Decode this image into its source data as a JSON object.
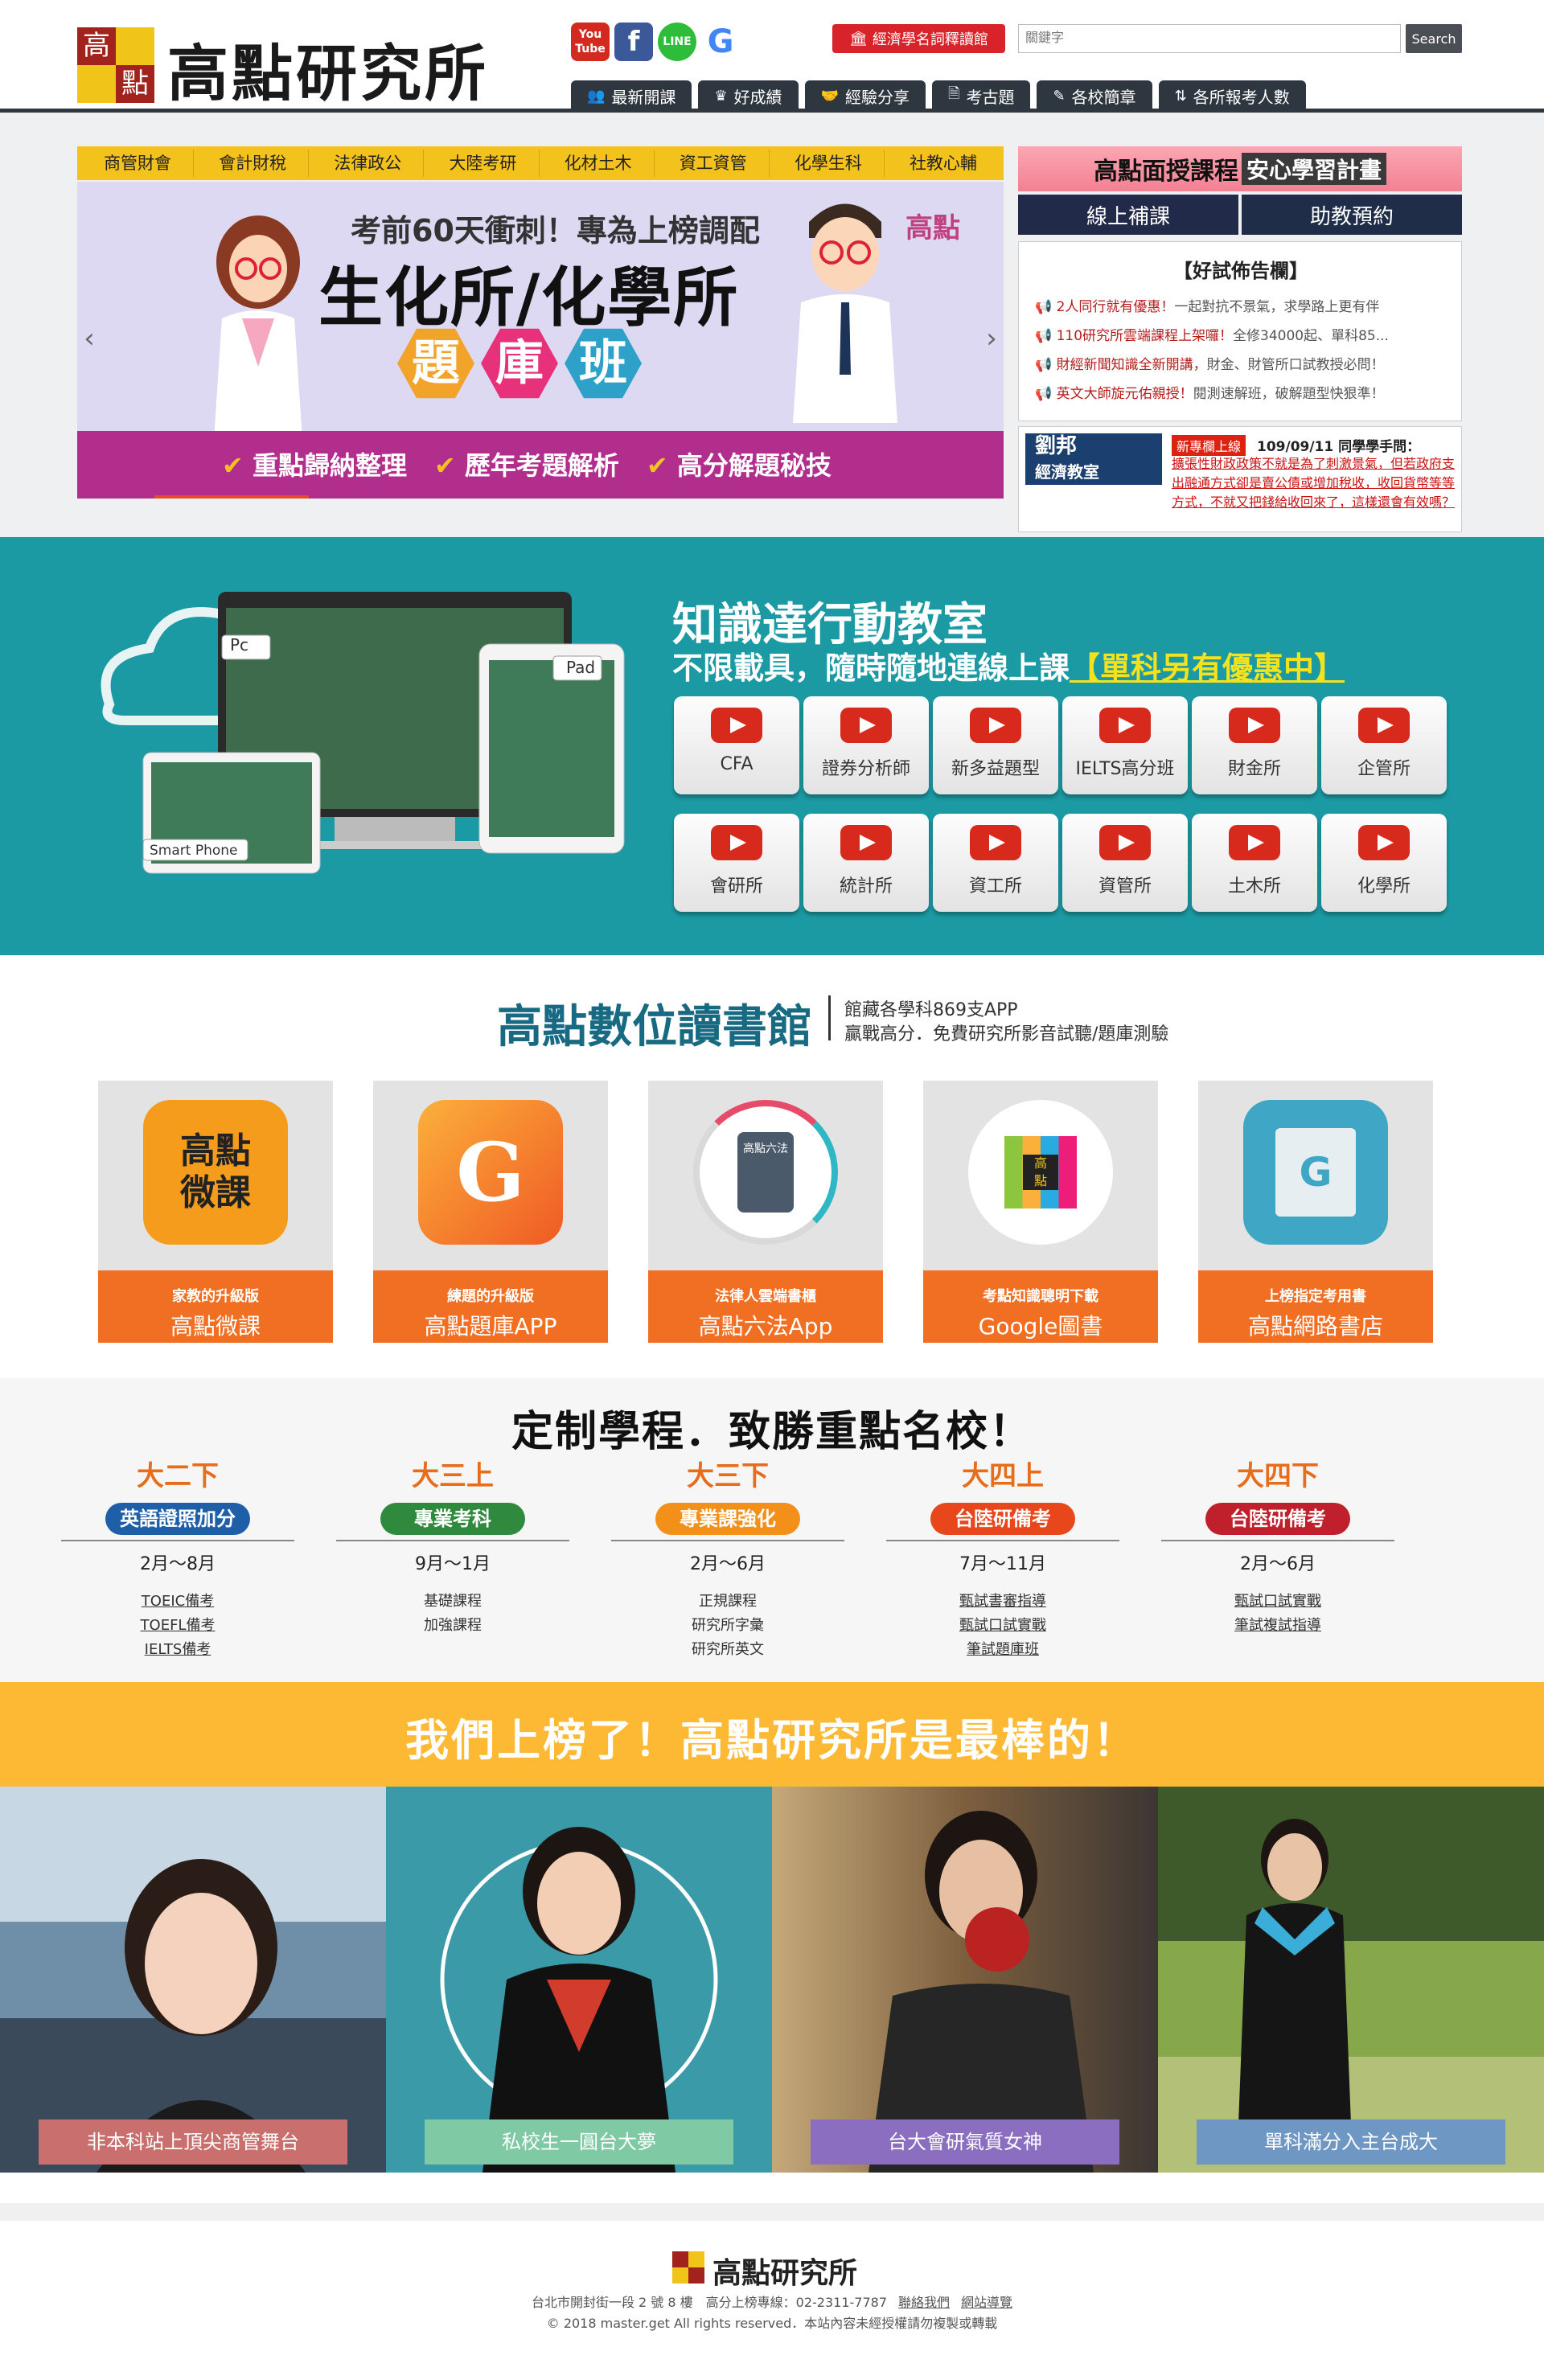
{
  "header": {
    "logo_chars": [
      "高",
      "點"
    ],
    "site_name": "高點研究所",
    "social": [
      {
        "name": "youtube",
        "label": "You\nTube",
        "color": "#d32a1f"
      },
      {
        "name": "facebook",
        "label": "f",
        "color": "#3b5998"
      },
      {
        "name": "line",
        "label": "LINE",
        "color": "#2dbd3b"
      },
      {
        "name": "google",
        "label": "G",
        "color": "#ffffff"
      }
    ],
    "econ_button": "經濟學名詞釋讀館",
    "search_placeholder": "關鍵字",
    "search_button": "Search",
    "nav": [
      {
        "label": "最新開課",
        "icon": "group-icon"
      },
      {
        "label": "好成績",
        "icon": "crown-icon"
      },
      {
        "label": "經驗分享",
        "icon": "handshake-icon"
      },
      {
        "label": "考古題",
        "icon": "document-icon"
      },
      {
        "label": "各校簡章",
        "icon": "edit-icon"
      },
      {
        "label": "各所報考人數",
        "icon": "sort-icon"
      }
    ]
  },
  "hero": {
    "subjects": [
      "商管財會",
      "會計財稅",
      "法律政公",
      "大陸考研",
      "化材土木",
      "資工資管",
      "化學生科",
      "社教心輔"
    ],
    "banner": {
      "line1": "考前60天衝刺！專為上榜調配",
      "line2": "生化所/化學所",
      "hex_chars": [
        "題",
        "庫",
        "班"
      ],
      "brand": "高點",
      "bullets": [
        "重點歸納整理",
        "歷年考題解析",
        "高分解題秘技"
      ]
    }
  },
  "sidebar": {
    "plan_title_a": "高點面授課程",
    "plan_title_b": "安心學習計畫",
    "tab_online": "線上補課",
    "tab_ta": "助教預約",
    "news_title": "【好試佈告欄】",
    "news": [
      {
        "red": "2人同行就有優惠！",
        "gray": "一起對抗不景氣，求學路上更有伴"
      },
      {
        "red": "110研究所雲端課程上架囉！",
        "gray": "全修34000起、單科85..."
      },
      {
        "red": "財經新聞知識全新開講，",
        "gray": "財金、財管所口試教授必問！"
      },
      {
        "red": "英文大師旋元佑親授！",
        "gray": "閱測速解班，破解題型快狠準！"
      }
    ],
    "ad": {
      "thumb_line1": "劉邦",
      "thumb_line2": "經濟教室",
      "tag": "新專欄上線",
      "date": "109/09/11 同學學手問：",
      "text": "擴張性財政政策不就是為了刺激景氣，但若政府支出融通方式卻是賣公債或增加稅收，收回貨幣等等方式，不就又把錢給收回來了，這樣還會有效嗎？"
    }
  },
  "mobile": {
    "title": "知識達行動教室",
    "sub_a": "不限載具，隨時隨地連線上課",
    "sub_b": "【單科另有優惠中】",
    "device_labels": [
      "Pc",
      "Pad",
      "Smart Phone"
    ],
    "buttons": [
      "CFA",
      "證券分析師",
      "新多益題型",
      "IELTS高分班",
      "財金所",
      "企管所",
      "會研所",
      "統計所",
      "資工所",
      "資管所",
      "土木所",
      "化學所"
    ]
  },
  "library": {
    "title": "高點數位讀書館",
    "line1": "館藏各學科869支APP",
    "line2": "贏戰高分．免費研究所影音試聽/題庫測驗",
    "cards": [
      {
        "small": "家教的升級版",
        "big": "高點微課",
        "icon_text": "高點\n微課"
      },
      {
        "small": "練題的升級版",
        "big": "高點題庫APP",
        "icon_text": "G"
      },
      {
        "small": "法律人雲端書櫃",
        "big": "高點六法App",
        "icon_text": "高點六法"
      },
      {
        "small": "考點知識聰明下載",
        "big": "Google圖書",
        "icon_text": "高\n點"
      },
      {
        "small": "上榜指定考用書",
        "big": "高點網路書店",
        "icon_text": "G"
      }
    ]
  },
  "program": {
    "title": "定制學程．致勝重點名校！",
    "stages": [
      {
        "year": "大二下",
        "pill": "英語證照加分",
        "color": "#1e5fa8",
        "months": "2月～8月",
        "links": [
          {
            "t": "TOEIC備考",
            "u": true
          },
          {
            "t": "TOEFL備考",
            "u": true
          },
          {
            "t": "IELTS備考",
            "u": true
          }
        ]
      },
      {
        "year": "大三上",
        "pill": "專業考科",
        "color": "#2f8a3d",
        "months": "9月～1月",
        "links": [
          {
            "t": "基礎課程",
            "u": false
          },
          {
            "t": "加強課程",
            "u": false
          }
        ]
      },
      {
        "year": "大三下",
        "pill": "專業課強化",
        "color": "#f39019",
        "months": "2月～6月",
        "links": [
          {
            "t": "正規課程",
            "u": false
          },
          {
            "t": "研究所字彙",
            "u": false
          },
          {
            "t": "研究所英文",
            "u": false
          }
        ]
      },
      {
        "year": "大四上",
        "pill": "台陸研備考",
        "color": "#e8471b",
        "months": "7月～11月",
        "links": [
          {
            "t": "甄試書審指導",
            "u": true
          },
          {
            "t": "甄試口試實戰",
            "u": true
          },
          {
            "t": "筆試題庫班",
            "u": true
          }
        ]
      },
      {
        "year": "大四下",
        "pill": "台陸研備考",
        "color": "#c0202b",
        "months": "2月～6月",
        "links": [
          {
            "t": "甄試口試實戰",
            "u": true
          },
          {
            "t": "筆試複試指導",
            "u": true
          }
        ]
      }
    ]
  },
  "winners": {
    "title": "我們上榜了！高點研究所是最棒的！",
    "photos": [
      {
        "caption": "非本科站上頂尖商管舞台",
        "cap_color": "#c96f6d"
      },
      {
        "caption": "私校生一圓台大夢",
        "cap_color": "#7fc9a4"
      },
      {
        "caption": "台大會研氣質女神",
        "cap_color": "#8b6ec0"
      },
      {
        "caption": "單科滿分入主台成大",
        "cap_color": "#6f97c4"
      }
    ]
  },
  "footer": {
    "name": "高點研究所",
    "address": "台北市開封街一段 2 號 8 樓　高分上榜專線：02-2311-7787",
    "link1": "聯絡我們",
    "link2": "網站導覽",
    "copyright": "© 2018 master.get All rights reserved．本站內容未經授權請勿複製或轉載"
  }
}
